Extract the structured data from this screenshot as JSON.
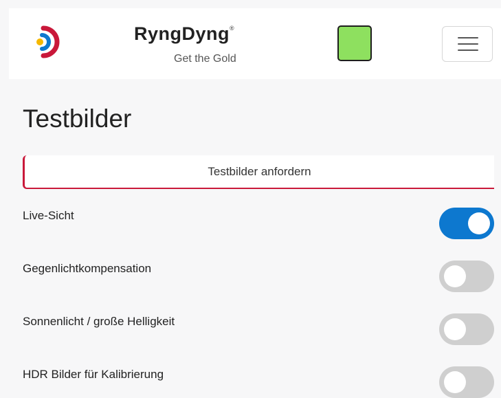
{
  "header": {
    "brand_name": "RyngDyng",
    "registered_mark": "®",
    "tagline": "Get the Gold",
    "app_icon": "target-icon",
    "status_indicator_color": "#8ee05f",
    "menu_icon": "hamburger-menu-icon"
  },
  "page": {
    "title": "Testbilder",
    "request_button_label": "Testbilder anfordern"
  },
  "toggles": [
    {
      "label": "Live-Sicht",
      "on": true
    },
    {
      "label": "Gegenlichtkompensation",
      "on": false
    },
    {
      "label": "Sonnenlicht / große Helligkeit",
      "on": false
    },
    {
      "label": "HDR Bilder für Kalibrierung",
      "on": false
    }
  ],
  "colors": {
    "accent_blue": "#0d78cf",
    "accent_red": "#c9183a",
    "toggle_off": "#cfcfcf",
    "icon_yellow": "#f5b800"
  }
}
